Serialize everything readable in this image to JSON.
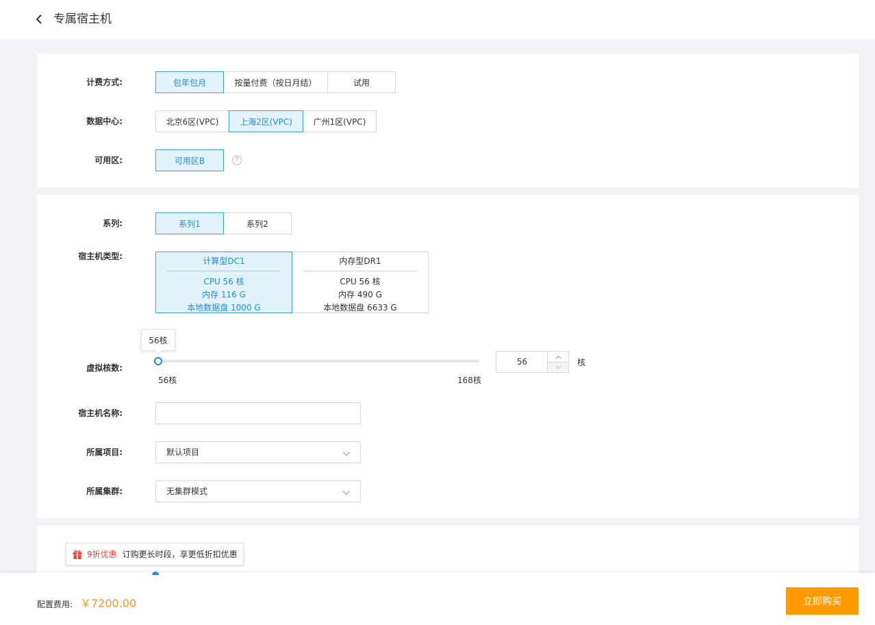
{
  "header": {
    "title": "专属宿主机"
  },
  "billing": {
    "label": "计费方式:",
    "options": [
      "包年包月",
      "按量付费（按日月结）",
      "试用"
    ],
    "selected": "包年包月"
  },
  "datacenter": {
    "label": "数据中心:",
    "options": [
      "北京6区(VPC)",
      "上海2区(VPC)",
      "广州1区(VPC)"
    ],
    "selected": "上海2区(VPC)"
  },
  "zone": {
    "label": "可用区:",
    "options": [
      "可用区B"
    ],
    "selected": "可用区B",
    "help_icon": "question-circle-icon",
    "help_glyph": "?"
  },
  "series": {
    "label": "系列:",
    "options": [
      "系列1",
      "系列2"
    ],
    "selected": "系列1"
  },
  "host_type": {
    "label": "宿主机类型:",
    "options": [
      {
        "name": "计算型DC1",
        "cpu": "CPU 56 核",
        "memory": "内存 116 G",
        "disk": "本地数据盘 1000 G"
      },
      {
        "name": "内存型DR1",
        "cpu": "CPU 56 核",
        "memory": "内存 490 G",
        "disk": "本地数据盘 6633 G"
      }
    ],
    "selected": "计算型DC1"
  },
  "vcores": {
    "label": "虚拟核数:",
    "tooltip": "56核",
    "min_label": "56核",
    "max_label": "168核",
    "min": 56,
    "max": 168,
    "value": "56",
    "unit": "核"
  },
  "host_name": {
    "label": "宿主机名称:",
    "value": ""
  },
  "project": {
    "label": "所属项目:",
    "value": "默认项目"
  },
  "cluster": {
    "label": "所属集群:",
    "value": "无集群模式"
  },
  "promo": {
    "highlight": "9折优惠",
    "text": "订购更长时段，享更低折扣优惠",
    "icon": "gift-icon"
  },
  "footer": {
    "fee_label": "配置费用:",
    "fee_value": "￥7200.00",
    "buy_label": "立即购买"
  },
  "colors": {
    "accent": "#1e8ed3",
    "selected_bg": "#e3f3fc",
    "price": "#f7941d",
    "buy_button": "#ff9a00",
    "promo_red": "#e9473e"
  }
}
